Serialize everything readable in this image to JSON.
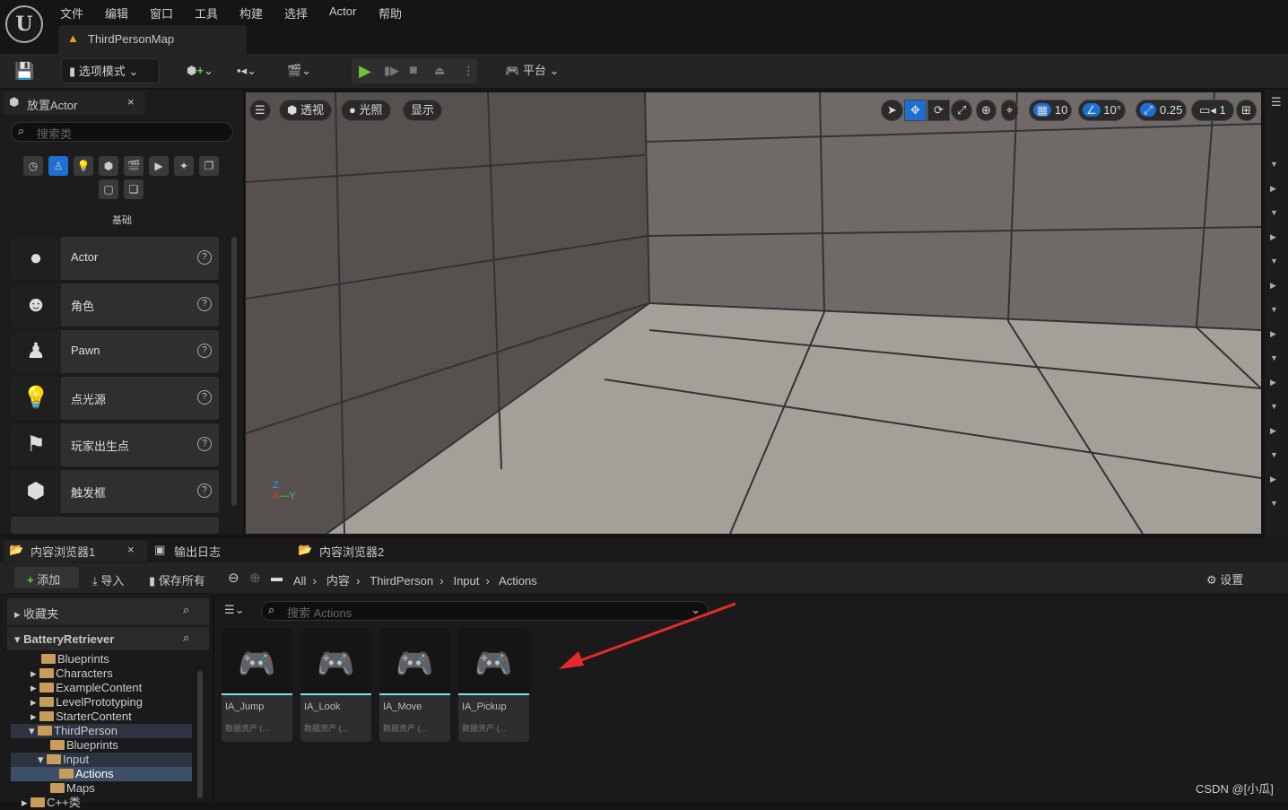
{
  "menu": [
    "文件",
    "编辑",
    "窗口",
    "工具",
    "构建",
    "选择",
    "Actor",
    "帮助"
  ],
  "map_tab": "ThirdPersonMap",
  "toolbar": {
    "mode": "选项模式",
    "platform": "平台"
  },
  "place_actor": {
    "tab": "放置Actor",
    "search_placeholder": "搜索类",
    "category": "基础",
    "items": [
      "Actor",
      "角色",
      "Pawn",
      "点光源",
      "玩家出生点",
      "触发框"
    ]
  },
  "viewport": {
    "perspective": "透视",
    "lighting": "光照",
    "show": "显示",
    "grid_snap": "10",
    "rot_snap": "10°",
    "scale_snap": "0.25",
    "camera_speed": "1",
    "active_color": "#1d6fd1"
  },
  "content_browser": {
    "tabs": [
      "内容浏览器1",
      "输出日志",
      "内容浏览器2"
    ],
    "add": "添加",
    "import": "导入",
    "save_all": "保存所有",
    "breadcrumb": [
      "All",
      "内容",
      "ThirdPerson",
      "Input",
      "Actions"
    ],
    "settings": "设置",
    "favorites": "收藏夹",
    "project": "BatteryRetriever",
    "search_placeholder": "搜索 Actions",
    "tree": [
      "Blueprints",
      "Characters",
      "ExampleContent",
      "LevelPrototyping",
      "StarterContent",
      "ThirdPerson",
      "Blueprints",
      "Input",
      "Actions",
      "Maps",
      "C++类"
    ],
    "assets": [
      {
        "name": "IA_Jump",
        "type": "数据资产 (..."
      },
      {
        "name": "IA_Look",
        "type": "数据资产 (..."
      },
      {
        "name": "IA_Move",
        "type": "数据资产 (..."
      },
      {
        "name": "IA_Pickup",
        "type": "数据资产 (..."
      }
    ]
  },
  "watermark": "CSDN @[小瓜]"
}
